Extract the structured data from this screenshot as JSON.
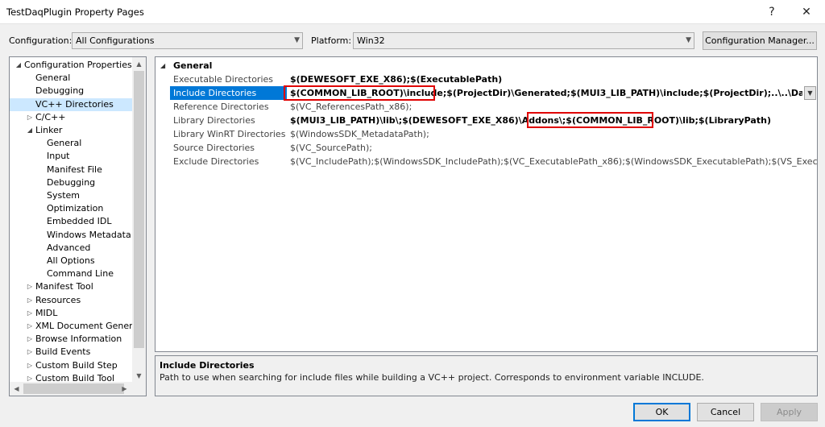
{
  "window": {
    "title": "TestDaqPlugin Property Pages",
    "help_glyph": "?",
    "close_glyph": "✕"
  },
  "config_bar": {
    "configuration_label": "Configuration:",
    "configuration_value": "All Configurations",
    "platform_label": "Platform:",
    "platform_value": "Win32",
    "manager_button": "Configuration Manager..."
  },
  "tree": {
    "items": [
      {
        "label": "Configuration Properties",
        "expander": "◢"
      },
      {
        "label": "General",
        "expander": ""
      },
      {
        "label": "Debugging",
        "expander": ""
      },
      {
        "label": "VC++ Directories",
        "expander": ""
      },
      {
        "label": "C/C++",
        "expander": "▷"
      },
      {
        "label": "Linker",
        "expander": "◢"
      },
      {
        "label": "General",
        "expander": ""
      },
      {
        "label": "Input",
        "expander": ""
      },
      {
        "label": "Manifest File",
        "expander": ""
      },
      {
        "label": "Debugging",
        "expander": ""
      },
      {
        "label": "System",
        "expander": ""
      },
      {
        "label": "Optimization",
        "expander": ""
      },
      {
        "label": "Embedded IDL",
        "expander": ""
      },
      {
        "label": "Windows Metadata",
        "expander": ""
      },
      {
        "label": "Advanced",
        "expander": ""
      },
      {
        "label": "All Options",
        "expander": ""
      },
      {
        "label": "Command Line",
        "expander": ""
      },
      {
        "label": "Manifest Tool",
        "expander": "▷"
      },
      {
        "label": "Resources",
        "expander": "▷"
      },
      {
        "label": "MIDL",
        "expander": "▷"
      },
      {
        "label": "XML Document Generator",
        "expander": "▷"
      },
      {
        "label": "Browse Information",
        "expander": "▷"
      },
      {
        "label": "Build Events",
        "expander": "▷"
      },
      {
        "label": "Custom Build Step",
        "expander": "▷"
      },
      {
        "label": "Custom Build Tool",
        "expander": "▷"
      }
    ]
  },
  "grid": {
    "category": "General",
    "category_expander": "◢",
    "properties": [
      {
        "name": "Executable Directories",
        "value": "$(DEWESOFT_EXE_X86);$(ExecutablePath)"
      },
      {
        "name": "Include Directories",
        "value": "$(COMMON_LIB_ROOT)\\include;$(ProjectDir)\\Generated;$(MUI3_LIB_PATH)\\include;$(ProjectDir);..\\..\\DaqSimulator\\DaqDe"
      },
      {
        "name": "Reference Directories",
        "value": "$(VC_ReferencesPath_x86);"
      },
      {
        "name": "Library Directories",
        "value": "$(MUI3_LIB_PATH)\\lib\\;$(DEWESOFT_EXE_X86)\\Addons\\;$(COMMON_LIB_ROOT)\\lib;$(LibraryPath)"
      },
      {
        "name": "Library WinRT Directories",
        "value": "$(WindowsSDK_MetadataPath);"
      },
      {
        "name": "Source Directories",
        "value": "$(VC_SourcePath);"
      },
      {
        "name": "Exclude Directories",
        "value": "$(VC_IncludePath);$(WindowsSDK_IncludePath);$(VC_ExecutablePath_x86);$(WindowsSDK_ExecutablePath);$(VS_ExecutablePath);$(FxCo"
      }
    ]
  },
  "description": {
    "title": "Include Directories",
    "text": "Path to use when searching for include files while building a VC++ project.  Corresponds to environment variable INCLUDE."
  },
  "buttons": {
    "ok": "OK",
    "cancel": "Cancel",
    "apply": "Apply"
  },
  "colors": {
    "selection_blue": "#0078d7",
    "tree_selection": "#cce8ff",
    "highlight_red": "#e00000"
  }
}
